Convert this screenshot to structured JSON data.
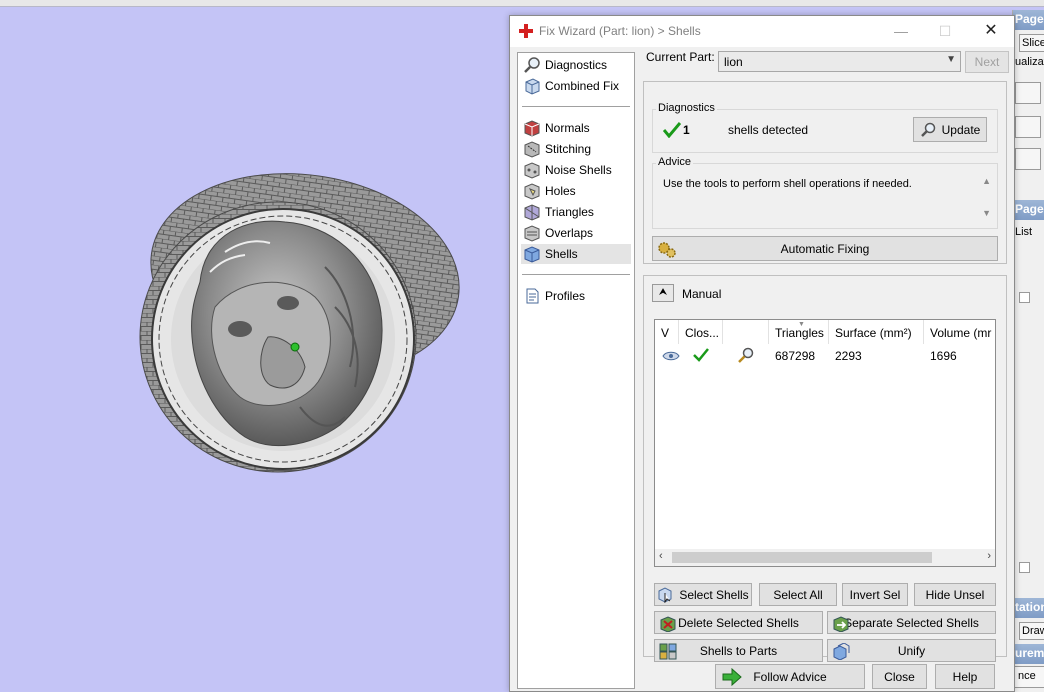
{
  "dialog": {
    "title": "Fix Wizard (Part: lion) > Shells",
    "controls": {
      "minimize": "—",
      "maximize": "☐",
      "close": "✕"
    }
  },
  "nav": {
    "top": [
      {
        "label": "Diagnostics",
        "icon": "magnifier-icon"
      },
      {
        "label": "Combined Fix",
        "icon": "cube-icon"
      }
    ],
    "tools": [
      {
        "label": "Normals",
        "icon": "normals-icon"
      },
      {
        "label": "Stitching",
        "icon": "stitching-icon"
      },
      {
        "label": "Noise Shells",
        "icon": "noise-shells-icon"
      },
      {
        "label": "Holes",
        "icon": "holes-icon"
      },
      {
        "label": "Triangles",
        "icon": "triangles-icon"
      },
      {
        "label": "Overlaps",
        "icon": "overlaps-icon"
      },
      {
        "label": "Shells",
        "icon": "shells-icon",
        "selected": true
      }
    ],
    "bottom": [
      {
        "label": "Profiles",
        "icon": "document-icon"
      }
    ]
  },
  "current_part": {
    "label": "Current Part:",
    "value": "lion",
    "next_label": "Next"
  },
  "diagnostics": {
    "title": "Diagnostics",
    "count": "1",
    "text": "shells detected",
    "update_label": "Update"
  },
  "advice": {
    "title": "Advice",
    "text": "Use the tools to perform shell operations if needed."
  },
  "automatic_fixing_label": "Automatic Fixing",
  "manual": {
    "label": "Manual",
    "columns": [
      "V",
      "Clos...",
      "",
      "Triangles",
      "Surface (mm²)",
      "Volume (mr"
    ],
    "rows": [
      {
        "triangles": "687298",
        "surface": "2293",
        "volume": "1696"
      }
    ],
    "buttons": {
      "select_shells": "Select Shells",
      "select_all": "Select All",
      "invert_sel": "Invert Sel",
      "hide_unsel": "Hide Unsel",
      "delete_selected": "Delete Selected Shells",
      "separate_selected": "Separate Selected Shells",
      "shells_to_parts": "Shells to Parts",
      "unify": "Unify"
    }
  },
  "footer": {
    "follow_advice": "Follow Advice",
    "close": "Close",
    "help": "Help"
  },
  "background_panel": {
    "header1": "Pages",
    "slice": "Slice",
    "visualization": "ualization",
    "header2": "Pages",
    "list": "List",
    "header3": "tation",
    "draw": "Draw",
    "header4": "urements",
    "ance": "nce"
  },
  "colors": {
    "viewport": "#c4c4f6",
    "check": "#1a9a1a",
    "title_cross": "#d42020"
  }
}
